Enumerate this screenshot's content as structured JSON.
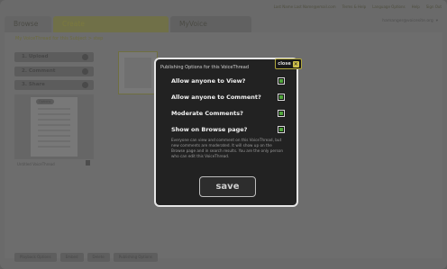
{
  "top_links": [
    "Last Name Last Name@email.com",
    "Terms & Help",
    "Language Options",
    "Help",
    "Sign Out"
  ],
  "tabs": {
    "browse": "Browse",
    "create": "Create",
    "myvoice": "MyVoice"
  },
  "user": {
    "email": "hamanger@voicesite.org",
    "caret": "▾"
  },
  "breadcrumb": "My VoiceThread for this Subject > step",
  "steps": [
    "1. Upload",
    "2. Comment",
    "3. Share"
  ],
  "thumbnail": {
    "edit_label": "Options",
    "caption": "Untitled VoiceThread"
  },
  "bottom_buttons": [
    "Playback Options",
    "Embed",
    "Delete",
    "Publishing Options"
  ],
  "modal": {
    "title": "Publishing Options for this VoiceThread",
    "close_label": "close",
    "close_glyph": "✕",
    "options": [
      {
        "label": "Allow anyone to View?",
        "checked": true
      },
      {
        "label": "Allow anyone to Comment?",
        "checked": true
      },
      {
        "label": "Moderate Comments?",
        "checked": true
      },
      {
        "label": "Show on Browse page?",
        "checked": true
      }
    ],
    "description": "Everyone can view and comment on this VoiceThread, but new comments are moderated. It will show up on the Browse page and in search results. You are the only person who can edit this VoiceThread.",
    "save_label": "save"
  },
  "colors": {
    "checkbox_mark": "#4fa53a",
    "close_accent": "#cfc04a"
  }
}
